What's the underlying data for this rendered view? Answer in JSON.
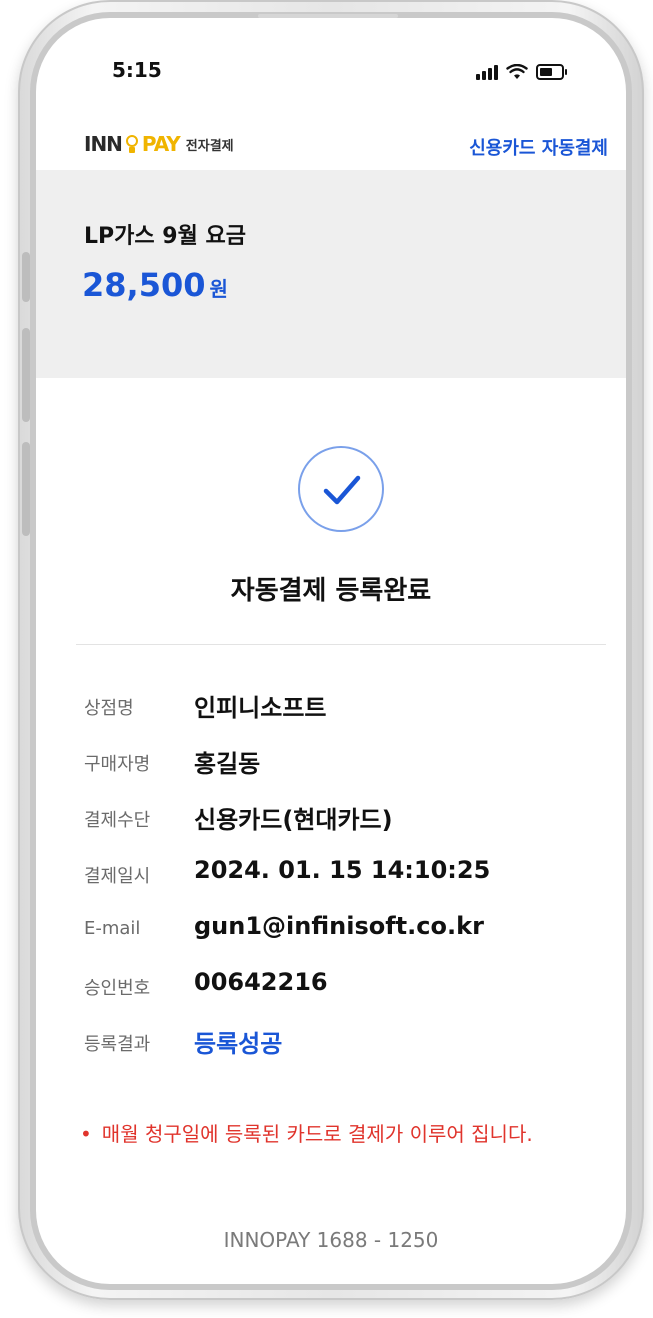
{
  "status_bar": {
    "time": "5:15"
  },
  "header": {
    "logo_inno": "INN",
    "logo_pay": "PAY",
    "logo_sub": "전자결제",
    "right_label": "신용카드 자동결제"
  },
  "summary": {
    "item_name": "LP가스 9월 요금",
    "amount": "28,500",
    "amount_unit": "원"
  },
  "success": {
    "title": "자동결제 등록완료"
  },
  "info": [
    {
      "label": "상점명",
      "value": "인피니소프트"
    },
    {
      "label": "구매자명",
      "value": "홍길동"
    },
    {
      "label": "결제수단",
      "value": "신용카드(현대카드)"
    },
    {
      "label": "결제일시",
      "value": "2024. 01. 15 14:10:25"
    },
    {
      "label": "E-mail",
      "value": "gun1@infinisoft.co.kr"
    },
    {
      "label": "승인번호",
      "value": "00642216"
    },
    {
      "label": "등록결과",
      "value": "등록성공"
    }
  ],
  "notice": {
    "bullet": "•",
    "text": "매월 청구일에 등록된 카드로 결제가 이루어 집니다."
  },
  "footer": {
    "text": "INNOPAY 1688 - 1250"
  },
  "colors": {
    "accent": "#1a56d6",
    "logo_yellow": "#f0b400",
    "warning": "#e0342c",
    "summary_bg": "#efefef"
  },
  "icons": {
    "status": [
      "signal-icon",
      "wifi-icon",
      "battery-icon"
    ],
    "success": "checkmark-icon"
  }
}
